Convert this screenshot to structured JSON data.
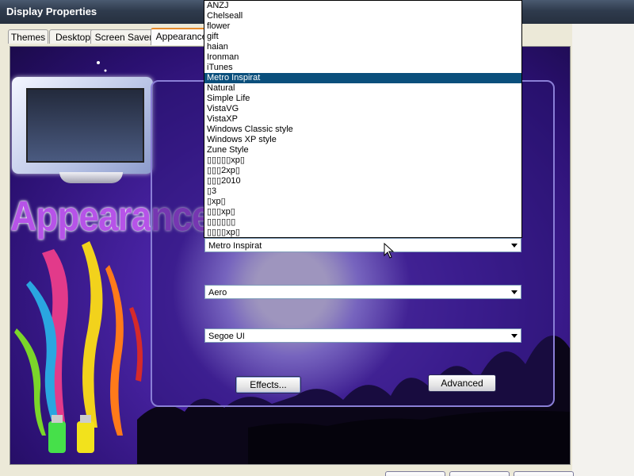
{
  "window": {
    "title": "Display Properties"
  },
  "tabs": [
    {
      "label": "Themes"
    },
    {
      "label": "Desktop"
    },
    {
      "label": "Screen Saver"
    },
    {
      "label": "Appearance"
    }
  ],
  "banner": {
    "word": "Appearance"
  },
  "dropdown": {
    "options": [
      "ANZJ",
      "Chelseall",
      "flower",
      "gift",
      "haian",
      "Ironman",
      "iTunes",
      "Metro Inspirat",
      "Natural",
      "Simple Life",
      "VistaVG",
      "VistaXP",
      "Windows Classic style",
      "Windows XP style",
      "Zune Style",
      "▯▯▯▯▯xp▯",
      "▯▯▯2xp▯",
      "▯▯▯2010",
      "▯3",
      "▯xp▯",
      "▯▯▯xp▯",
      "▯▯▯▯▯▯",
      "▯▯▯▯xp▯"
    ],
    "selected": "Metro Inspirat"
  },
  "combos": {
    "scheme": "Metro Inspirat",
    "color": "Aero",
    "font": "Segoe UI"
  },
  "buttons": {
    "effects": "Effects...",
    "advanced": "Advanced"
  },
  "colors": {
    "selection": "#0a4f7c",
    "tab_accent": "#e68b2c",
    "title_bar": "#2f3b4d",
    "banner_text": "#b653e8"
  },
  "icons": [
    "mouse-cursor-icon",
    "dropdown-arrow-icon"
  ]
}
